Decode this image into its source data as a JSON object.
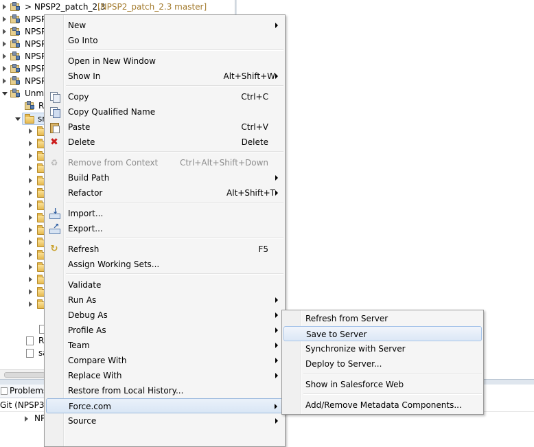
{
  "tree": {
    "first_row": {
      "name": "> NPSP2_patch_2.3",
      "branch": "[NPSP2_patch_2.3 master]"
    },
    "rows": [
      "NPSP",
      "NPSP",
      "NPSP",
      "NPSP",
      "NPSP",
      "NPSP"
    ],
    "unm_label": "Unm",
    "r_label": "R",
    "s_label": "sr",
    "r2_label": "R",
    "sa_label": "sa"
  },
  "panels": {
    "problems_tab": "Problems",
    "git_label": "Git (NPSP3_p",
    "np_label": "NP"
  },
  "context_menu": {
    "items": [
      {
        "label": "New",
        "shortcut": "",
        "submenu": true
      },
      {
        "label": "Go Into",
        "shortcut": ""
      },
      {
        "label": "Open in New Window",
        "shortcut": ""
      },
      {
        "label": "Show In",
        "shortcut": "Alt+Shift+W",
        "submenu": true
      },
      {
        "label": "Copy",
        "shortcut": "Ctrl+C",
        "icon": "copy-icon"
      },
      {
        "label": "Copy Qualified Name",
        "shortcut": "",
        "icon": "copy-qualified-name-icon"
      },
      {
        "label": "Paste",
        "shortcut": "Ctrl+V",
        "icon": "paste-icon"
      },
      {
        "label": "Delete",
        "shortcut": "Delete",
        "icon": "delete-icon"
      },
      {
        "label": "Remove from Context",
        "shortcut": "Ctrl+Alt+Shift+Down",
        "disabled": true,
        "icon": "remove-context-icon"
      },
      {
        "label": "Build Path",
        "shortcut": "",
        "submenu": true
      },
      {
        "label": "Refactor",
        "shortcut": "Alt+Shift+T",
        "submenu": true
      },
      {
        "label": "Import...",
        "shortcut": "",
        "icon": "import-icon"
      },
      {
        "label": "Export...",
        "shortcut": "",
        "icon": "export-icon"
      },
      {
        "label": "Refresh",
        "shortcut": "F5",
        "icon": "refresh-icon"
      },
      {
        "label": "Assign Working Sets...",
        "shortcut": ""
      },
      {
        "label": "Validate",
        "shortcut": ""
      },
      {
        "label": "Run As",
        "shortcut": "",
        "submenu": true
      },
      {
        "label": "Debug As",
        "shortcut": "",
        "submenu": true
      },
      {
        "label": "Profile As",
        "shortcut": "",
        "submenu": true
      },
      {
        "label": "Team",
        "shortcut": "",
        "submenu": true
      },
      {
        "label": "Compare With",
        "shortcut": "",
        "submenu": true
      },
      {
        "label": "Replace With",
        "shortcut": "",
        "submenu": true
      },
      {
        "label": "Restore from Local History...",
        "shortcut": ""
      },
      {
        "label": "Force.com",
        "shortcut": "",
        "submenu": true,
        "active": true
      },
      {
        "label": "Source",
        "shortcut": "",
        "submenu": true
      }
    ]
  },
  "submenu": {
    "items": [
      {
        "label": "Refresh from Server"
      },
      {
        "label": "Save to Server",
        "hovered": true
      },
      {
        "label": "Synchronize with Server"
      },
      {
        "label": "Deploy to Server..."
      },
      {
        "label": "Show in Salesforce Web"
      },
      {
        "label": "Add/Remove Metadata Components..."
      }
    ]
  }
}
